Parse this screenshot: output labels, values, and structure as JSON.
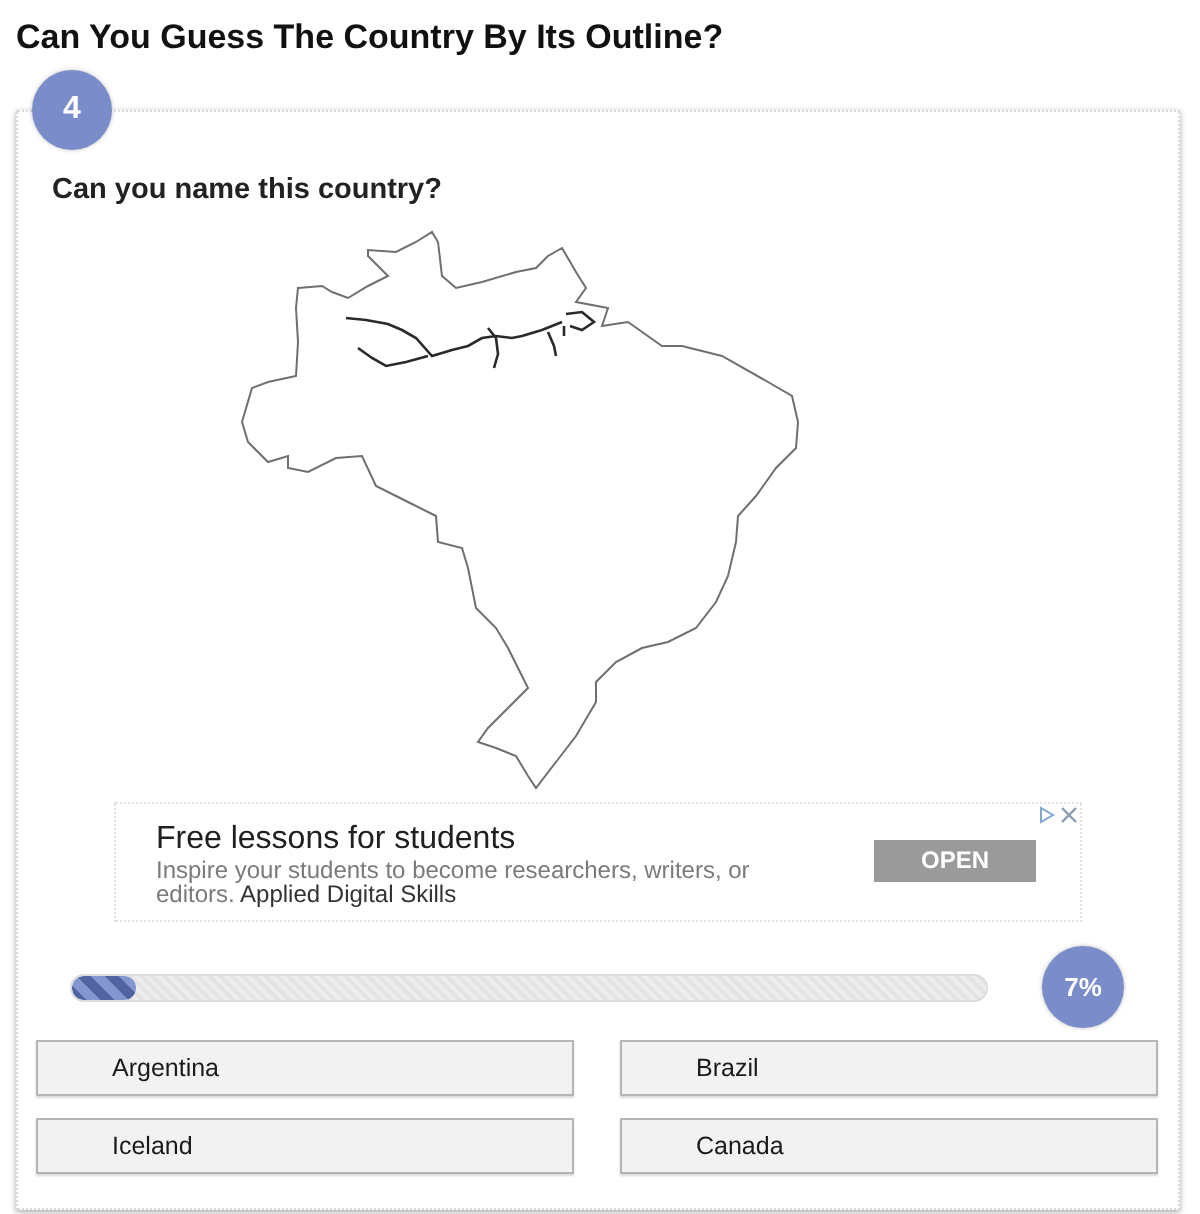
{
  "page": {
    "title": "Can You Guess The Country By Its Outline?"
  },
  "question": {
    "number": "4",
    "text": "Can you name this country?"
  },
  "ad": {
    "title": "Free lessons for students",
    "description": "Inspire your students to become researchers, writers, or editors.",
    "advertiser": "Applied Digital Skills",
    "button": "OPEN"
  },
  "progress": {
    "level": 0.07,
    "label": "7%"
  },
  "answers": [
    "Argentina",
    "Brazil",
    "Iceland",
    "Canada"
  ]
}
